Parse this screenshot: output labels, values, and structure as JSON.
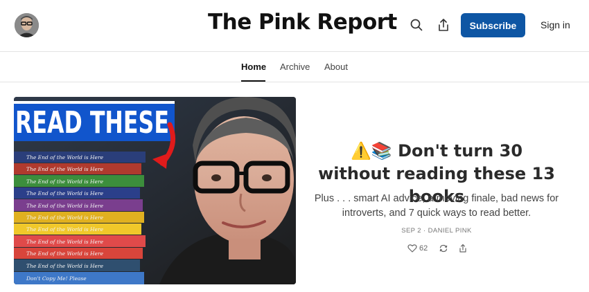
{
  "header": {
    "site_title": "The Pink Report",
    "subscribe_label": "Subscribe",
    "signin_label": "Sign in",
    "accent_color": "#0e56a4",
    "icons": [
      "search-icon",
      "share-icon"
    ]
  },
  "nav": {
    "tabs": [
      {
        "label": "Home",
        "active": true
      },
      {
        "label": "Archive",
        "active": false
      },
      {
        "label": "About",
        "active": false
      }
    ]
  },
  "post": {
    "thumbnail": {
      "banner_text": "READ THESE",
      "book_spines": [
        "The End of the World is Here",
        "The End of the World is Here",
        "The End of the World is Here",
        "The End of the World is Here",
        "The End of the World is Here",
        "The End of the World is Here",
        "The End of the World is Here",
        "The End of the World is Here",
        "The End of the World is Here",
        "The End of the World is Here",
        "Don't Copy Me! Please"
      ]
    },
    "title": "⚠️📚 Don't turn 30 without reading these 13 books",
    "subtitle": "Plus . . . smart AI advice, a moving finale, bad news for introverts, and 7 quick ways to read better.",
    "meta": "SEP 2 · DANIEL PINK",
    "like_count": "62"
  }
}
